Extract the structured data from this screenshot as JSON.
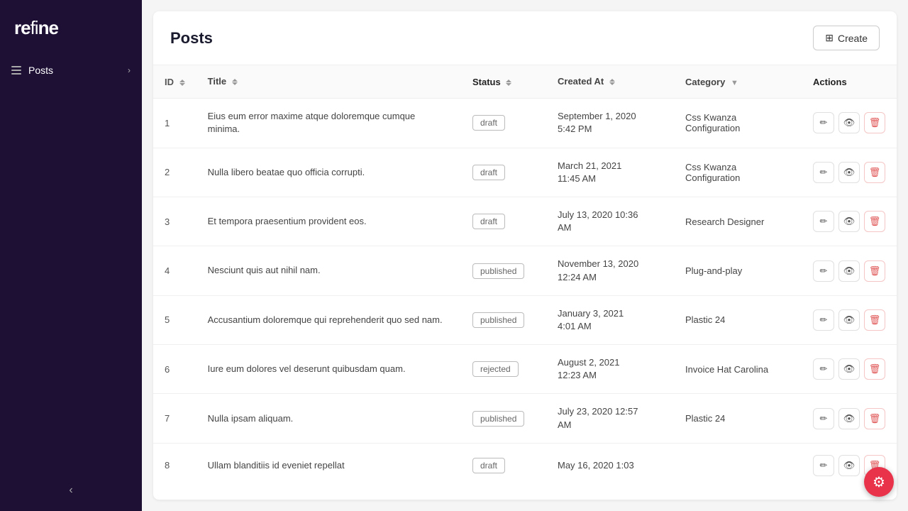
{
  "app": {
    "name": "refine"
  },
  "sidebar": {
    "items": [
      {
        "id": "posts",
        "label": "Posts",
        "active": true
      }
    ],
    "collapse_label": "‹"
  },
  "page": {
    "title": "Posts",
    "create_button": "Create"
  },
  "table": {
    "columns": [
      {
        "id": "id",
        "label": "ID",
        "sortable": true
      },
      {
        "id": "title",
        "label": "Title",
        "sortable": true
      },
      {
        "id": "status",
        "label": "Status",
        "sortable": true
      },
      {
        "id": "created_at",
        "label": "Created At",
        "sortable": true
      },
      {
        "id": "category",
        "label": "Category",
        "filterable": true
      },
      {
        "id": "actions",
        "label": "Actions",
        "sortable": false
      }
    ],
    "rows": [
      {
        "id": 1,
        "title": "Eius eum error maxime atque doloremque cumque minima.",
        "status": "draft",
        "created_at": "September 1, 2020\n5:42 PM",
        "category": "Css Kwanza Configuration"
      },
      {
        "id": 2,
        "title": "Nulla libero beatae quo officia corrupti.",
        "status": "draft",
        "created_at": "March 21, 2021\n11:45 AM",
        "category": "Css Kwanza Configuration"
      },
      {
        "id": 3,
        "title": "Et tempora praesentium provident eos.",
        "status": "draft",
        "created_at": "July 13, 2020 10:36\nAM",
        "category": "Research Designer"
      },
      {
        "id": 4,
        "title": "Nesciunt quis aut nihil nam.",
        "status": "published",
        "created_at": "November 13, 2020\n12:24 AM",
        "category": "Plug-and-play"
      },
      {
        "id": 5,
        "title": "Accusantium doloremque qui reprehenderit quo sed nam.",
        "status": "published",
        "created_at": "January 3, 2021\n4:01 AM",
        "category": "Plastic 24"
      },
      {
        "id": 6,
        "title": "Iure eum dolores vel deserunt quibusdam quam.",
        "status": "rejected",
        "created_at": "August 2, 2021\n12:23 AM",
        "category": "Invoice Hat Carolina"
      },
      {
        "id": 7,
        "title": "Nulla ipsam aliquam.",
        "status": "published",
        "created_at": "July 23, 2020 12:57\nAM",
        "category": "Plastic 24"
      },
      {
        "id": 8,
        "title": "Ullam blanditiis id eveniet repellat",
        "status": "draft",
        "created_at": "May 16, 2020 1:03",
        "category": ""
      }
    ]
  },
  "icons": {
    "create": "⊞",
    "edit": "✏",
    "view": "👁",
    "delete": "🗑",
    "settings": "⚙",
    "collapse": "‹",
    "chevron_right": "›"
  }
}
